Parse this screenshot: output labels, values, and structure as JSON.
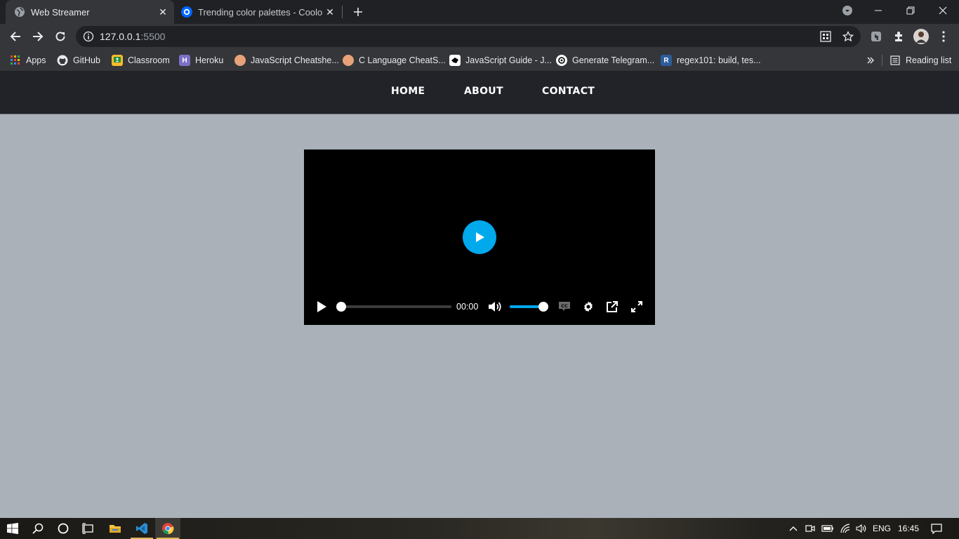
{
  "browser": {
    "tabs": [
      {
        "title": "Web Streamer",
        "active": true
      },
      {
        "title": "Trending color palettes - Coolors",
        "active": false
      }
    ],
    "url_host": "127.0.0.1",
    "url_port": ":5500",
    "bookmarks": [
      {
        "label": "Apps",
        "icon": "apps-grid-icon"
      },
      {
        "label": "GitHub",
        "icon": "github-icon"
      },
      {
        "label": "Classroom",
        "icon": "classroom-icon"
      },
      {
        "label": "Heroku",
        "icon": "heroku-icon"
      },
      {
        "label": "JavaScript Cheatshe...",
        "icon": "avatar-icon"
      },
      {
        "label": "C Language CheatS...",
        "icon": "avatar-icon"
      },
      {
        "label": "JavaScript Guide - J...",
        "icon": "bookmark-favicon-icon"
      },
      {
        "label": "Generate Telegram...",
        "icon": "bookmark-favicon-icon"
      },
      {
        "label": "regex101: build, tes...",
        "icon": "regex101-icon"
      }
    ],
    "regex_icon_letter": "R",
    "reading_list_label": "Reading list"
  },
  "page": {
    "nav": {
      "home": "HOME",
      "about": "ABOUT",
      "contact": "CONTACT"
    },
    "player": {
      "time": "00:00",
      "progress_fraction": 0.0,
      "volume_fraction": 1.0,
      "accent": "#00a8ec"
    },
    "background": "#aab1b9",
    "navbar_color": "#212328"
  },
  "taskbar": {
    "language": "ENG",
    "clock": "16:45"
  }
}
